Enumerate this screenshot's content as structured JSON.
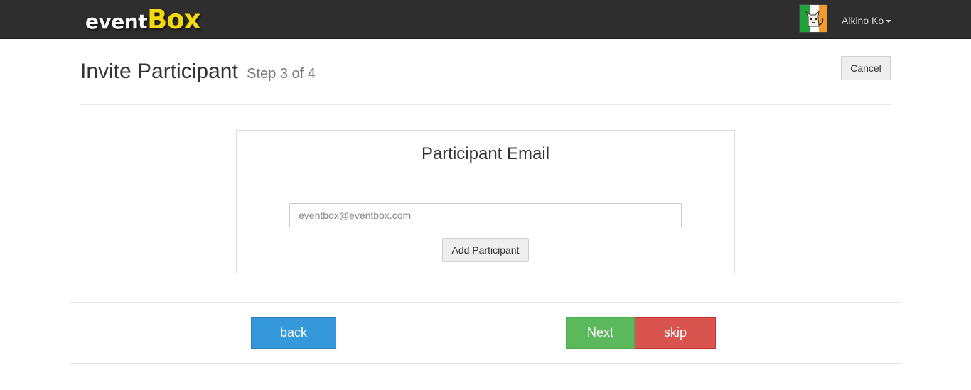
{
  "navbar": {
    "brand_part1": "event",
    "brand_part2": "Box",
    "avatar_icon": "cat-avatar-icon",
    "user_name": "Alkino Ko",
    "colors": {
      "background": "#2e2e2e",
      "brand_accent": "#f5d90a"
    }
  },
  "header": {
    "title": "Invite Participant",
    "subtitle": "Step 3 of 4",
    "cancel_label": "Cancel"
  },
  "panel": {
    "title": "Participant Email",
    "email_placeholder": "eventbox@eventbox.com",
    "email_value": "",
    "add_label": "Add Participant"
  },
  "footer_nav": {
    "back_label": "back",
    "next_label": "Next",
    "skip_label": "skip",
    "colors": {
      "back": "#3498db",
      "next": "#5cb85c",
      "skip": "#d9534f"
    }
  }
}
